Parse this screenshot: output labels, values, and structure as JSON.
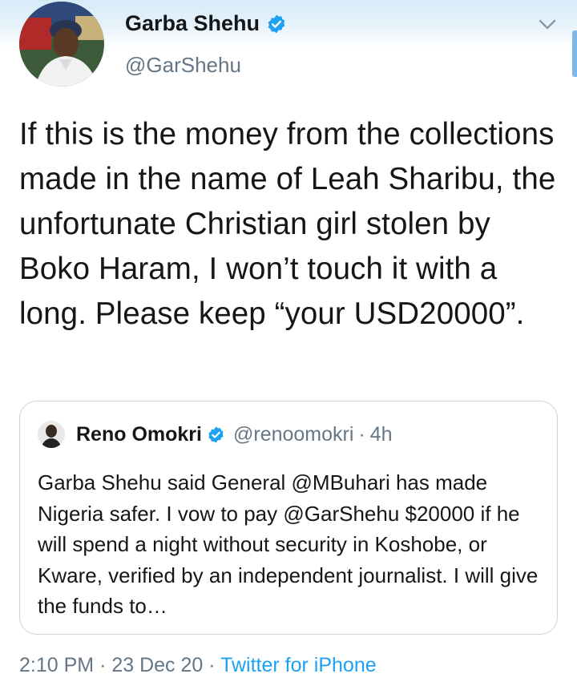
{
  "author": {
    "name": "Garba Shehu",
    "handle": "@GarShehu",
    "verified": true
  },
  "tweet": {
    "text": "If this is the money from the collections made in the name of Leah Sharibu, the unfortunate Christian girl stolen by Boko Haram, I won’t touch it with a long. Please keep “your USD20000”."
  },
  "quoted_tweet": {
    "name": "Reno Omokri",
    "handle": "@renoomokri",
    "separator": "·",
    "time": "4h",
    "verified": true,
    "text": "Garba Shehu said General @MBuhari has made Nigeria safer. I vow to pay @GarShehu $20000 if he will spend a night without security in Koshobe, or Kware, verified by an independent journalist. I will give the funds to…"
  },
  "meta": {
    "time": "2:10 PM",
    "separator_1": "·",
    "date": "23 Dec 20",
    "separator_2": "·",
    "source": "Twitter for iPhone"
  },
  "colors": {
    "link": "#1da1f2",
    "secondary_text": "#657786",
    "border": "#ccd6dd",
    "verified_badge": "#1da1f2"
  },
  "icons": {
    "verified": "verified-badge-icon",
    "more": "chevron-down-icon"
  }
}
